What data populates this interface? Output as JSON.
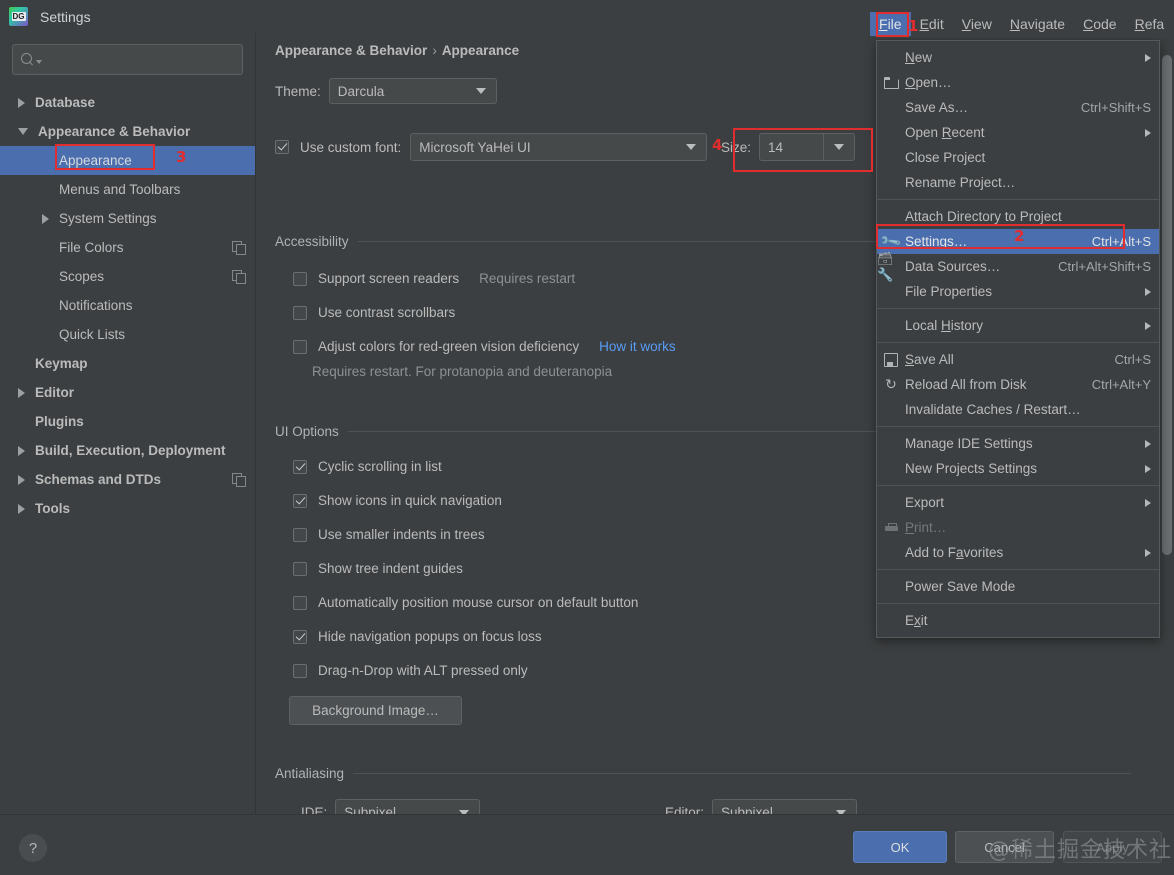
{
  "window": {
    "title": "Settings",
    "app_icon": "datagrip-icon"
  },
  "colors": {
    "accent_selection": "#4b6eaf",
    "annotation_red": "#e12d2d",
    "link_blue": "#589df6",
    "panel_bg": "#3c3f41",
    "field_bg": "#45494a"
  },
  "sidebar": {
    "search": {
      "placeholder": "",
      "value": "",
      "icon": "search-icon"
    },
    "items": [
      {
        "label": "Database",
        "level": 0,
        "arrow": "right",
        "bold": true,
        "selected": false,
        "copy_icon": false
      },
      {
        "label": "Appearance & Behavior",
        "level": 0,
        "arrow": "down",
        "bold": true,
        "selected": false,
        "copy_icon": false
      },
      {
        "label": "Appearance",
        "level": 1,
        "arrow": "none",
        "bold": false,
        "selected": true,
        "copy_icon": false
      },
      {
        "label": "Menus and Toolbars",
        "level": 1,
        "arrow": "none",
        "bold": false,
        "selected": false,
        "copy_icon": false
      },
      {
        "label": "System Settings",
        "level": 1,
        "arrow": "right",
        "bold": false,
        "selected": false,
        "copy_icon": false
      },
      {
        "label": "File Colors",
        "level": 1,
        "arrow": "none",
        "bold": false,
        "selected": false,
        "copy_icon": true
      },
      {
        "label": "Scopes",
        "level": 1,
        "arrow": "none",
        "bold": false,
        "selected": false,
        "copy_icon": true
      },
      {
        "label": "Notifications",
        "level": 1,
        "arrow": "none",
        "bold": false,
        "selected": false,
        "copy_icon": false
      },
      {
        "label": "Quick Lists",
        "level": 1,
        "arrow": "none",
        "bold": false,
        "selected": false,
        "copy_icon": false
      },
      {
        "label": "Keymap",
        "level": 0,
        "arrow": "none",
        "bold": true,
        "selected": false,
        "copy_icon": false
      },
      {
        "label": "Editor",
        "level": 0,
        "arrow": "right",
        "bold": true,
        "selected": false,
        "copy_icon": false
      },
      {
        "label": "Plugins",
        "level": 0,
        "arrow": "none",
        "bold": true,
        "selected": false,
        "copy_icon": false
      },
      {
        "label": "Build, Execution, Deployment",
        "level": 0,
        "arrow": "right",
        "bold": true,
        "selected": false,
        "copy_icon": false
      },
      {
        "label": "Schemas and DTDs",
        "level": 0,
        "arrow": "right",
        "bold": true,
        "selected": false,
        "copy_icon": true
      },
      {
        "label": "Tools",
        "level": 0,
        "arrow": "right",
        "bold": true,
        "selected": false,
        "copy_icon": false
      }
    ]
  },
  "main": {
    "breadcrumb": {
      "parent": "Appearance & Behavior",
      "separator": "›",
      "current": "Appearance"
    },
    "theme": {
      "label": "Theme:",
      "value": "Darcula"
    },
    "custom_font": {
      "checkbox_label": "Use custom font:",
      "checked": true,
      "value": "Microsoft YaHei UI",
      "size_label": "Size:",
      "size_value": "14"
    },
    "accessibility": {
      "group_title": "Accessibility",
      "options": [
        {
          "label": "Support screen readers",
          "checked": false,
          "note": "Requires restart",
          "link": ""
        },
        {
          "label": "Use contrast scrollbars",
          "checked": false,
          "note": "",
          "link": ""
        },
        {
          "label": "Adjust colors for red-green vision deficiency",
          "checked": false,
          "note": "",
          "link": "How it works"
        }
      ],
      "hint": "Requires restart. For protanopia and deuteranopia"
    },
    "ui_options": {
      "group_title": "UI Options",
      "options": [
        {
          "label": "Cyclic scrolling in list",
          "checked": true
        },
        {
          "label": "Show icons in quick navigation",
          "checked": true
        },
        {
          "label": "Use smaller indents in trees",
          "checked": false
        },
        {
          "label": "Show tree indent guides",
          "checked": false
        },
        {
          "label": "Automatically position mouse cursor on default button",
          "checked": false
        },
        {
          "label": "Hide navigation popups on focus loss",
          "checked": true
        },
        {
          "label": "Drag-n-Drop with ALT pressed only",
          "checked": false
        }
      ],
      "background_image_button": "Background Image…"
    },
    "antialiasing": {
      "group_title": "Antialiasing",
      "ide_label": "IDE:",
      "ide_value": "Subpixel",
      "editor_label": "Editor:",
      "editor_value": "Subpixel"
    }
  },
  "footer": {
    "help_icon": "question-mark-icon",
    "ok": "OK",
    "cancel": "Cancel",
    "apply": "Apply",
    "watermark": "@稀土掘金技术社区"
  },
  "menubar": {
    "items": [
      {
        "pre": "",
        "mn": "F",
        "post": "ile",
        "active": true
      },
      {
        "pre": "",
        "mn": "E",
        "post": "dit",
        "active": false
      },
      {
        "pre": "",
        "mn": "V",
        "post": "iew",
        "active": false
      },
      {
        "pre": "",
        "mn": "N",
        "post": "avigate",
        "active": false
      },
      {
        "pre": "",
        "mn": "C",
        "post": "ode",
        "active": false
      },
      {
        "pre": "",
        "mn": "R",
        "post": "efa",
        "active": false
      }
    ]
  },
  "file_menu": {
    "rows": [
      {
        "kind": "item",
        "icon": "",
        "pre": "",
        "mn": "N",
        "post": "ew",
        "shortcut": "",
        "submenu": true,
        "highlight": false,
        "disabled": false
      },
      {
        "kind": "item",
        "icon": "folder-icon",
        "pre": "",
        "mn": "O",
        "post": "pen…",
        "shortcut": "",
        "submenu": false,
        "highlight": false,
        "disabled": false
      },
      {
        "kind": "item",
        "icon": "",
        "pre": "Save As…",
        "mn": "",
        "post": "",
        "shortcut": "Ctrl+Shift+S",
        "submenu": false,
        "highlight": false,
        "disabled": false
      },
      {
        "kind": "item",
        "icon": "",
        "pre": "Open ",
        "mn": "R",
        "post": "ecent",
        "shortcut": "",
        "submenu": true,
        "highlight": false,
        "disabled": false
      },
      {
        "kind": "item",
        "icon": "",
        "pre": "Close Project",
        "mn": "",
        "post": "",
        "shortcut": "",
        "submenu": false,
        "highlight": false,
        "disabled": false
      },
      {
        "kind": "item",
        "icon": "",
        "pre": "Rename Project…",
        "mn": "",
        "post": "",
        "shortcut": "",
        "submenu": false,
        "highlight": false,
        "disabled": false
      },
      {
        "kind": "divider"
      },
      {
        "kind": "item",
        "icon": "",
        "pre": "Attach Directory to Project",
        "mn": "",
        "post": "",
        "shortcut": "",
        "submenu": false,
        "highlight": false,
        "disabled": false
      },
      {
        "kind": "item",
        "icon": "wrench-icon",
        "pre": "Se",
        "mn": "t",
        "post": "tings…",
        "shortcut": "Ctrl+Alt+S",
        "submenu": false,
        "highlight": true,
        "disabled": false
      },
      {
        "kind": "item",
        "icon": "data-sources-icon",
        "pre": "Data Sources…",
        "mn": "",
        "post": "",
        "shortcut": "Ctrl+Alt+Shift+S",
        "submenu": false,
        "highlight": false,
        "disabled": false
      },
      {
        "kind": "item",
        "icon": "",
        "pre": "File Properties",
        "mn": "",
        "post": "",
        "shortcut": "",
        "submenu": true,
        "highlight": false,
        "disabled": false
      },
      {
        "kind": "divider"
      },
      {
        "kind": "item",
        "icon": "",
        "pre": "Local ",
        "mn": "H",
        "post": "istory",
        "shortcut": "",
        "submenu": true,
        "highlight": false,
        "disabled": false
      },
      {
        "kind": "divider"
      },
      {
        "kind": "item",
        "icon": "save-icon",
        "pre": "",
        "mn": "S",
        "post": "ave All",
        "shortcut": "Ctrl+S",
        "submenu": false,
        "highlight": false,
        "disabled": false
      },
      {
        "kind": "item",
        "icon": "reload-icon",
        "pre": "Reload All from Disk",
        "mn": "",
        "post": "",
        "shortcut": "Ctrl+Alt+Y",
        "submenu": false,
        "highlight": false,
        "disabled": false
      },
      {
        "kind": "item",
        "icon": "",
        "pre": "Invalidate Caches / Restart…",
        "mn": "",
        "post": "",
        "shortcut": "",
        "submenu": false,
        "highlight": false,
        "disabled": false
      },
      {
        "kind": "divider"
      },
      {
        "kind": "item",
        "icon": "",
        "pre": "Manage IDE Settings",
        "mn": "",
        "post": "",
        "shortcut": "",
        "submenu": true,
        "highlight": false,
        "disabled": false
      },
      {
        "kind": "item",
        "icon": "",
        "pre": "New Projects Settings",
        "mn": "",
        "post": "",
        "shortcut": "",
        "submenu": true,
        "highlight": false,
        "disabled": false
      },
      {
        "kind": "divider"
      },
      {
        "kind": "item",
        "icon": "",
        "pre": "Export",
        "mn": "",
        "post": "",
        "shortcut": "",
        "submenu": true,
        "highlight": false,
        "disabled": false
      },
      {
        "kind": "item",
        "icon": "print-icon",
        "pre": "",
        "mn": "P",
        "post": "rint…",
        "shortcut": "",
        "submenu": false,
        "highlight": false,
        "disabled": true
      },
      {
        "kind": "item",
        "icon": "",
        "pre": "Add to F",
        "mn": "a",
        "post": "vorites",
        "shortcut": "",
        "submenu": true,
        "highlight": false,
        "disabled": false
      },
      {
        "kind": "divider"
      },
      {
        "kind": "item",
        "icon": "",
        "pre": "Power Save Mode",
        "mn": "",
        "post": "",
        "shortcut": "",
        "submenu": false,
        "highlight": false,
        "disabled": false
      },
      {
        "kind": "divider"
      },
      {
        "kind": "item",
        "icon": "",
        "pre": "E",
        "mn": "x",
        "post": "it",
        "shortcut": "",
        "submenu": false,
        "highlight": false,
        "disabled": false
      }
    ]
  },
  "annotations": [
    {
      "number": "1",
      "target": "menubar-file"
    },
    {
      "number": "2",
      "target": "file-menu-settings"
    },
    {
      "number": "3",
      "target": "sidebar-appearance"
    },
    {
      "number": "4",
      "target": "font-size-field"
    }
  ]
}
